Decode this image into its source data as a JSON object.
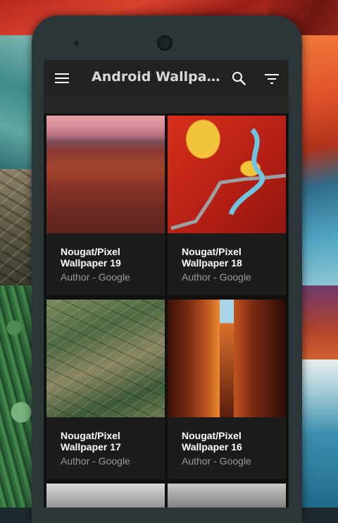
{
  "appbar": {
    "title": "Android Wallpap..."
  },
  "icons": {
    "menu": "menu-icon",
    "search": "search-icon",
    "filter": "filter-icon"
  },
  "wallpapers": [
    {
      "title": "Nougat/Pixel Wallpaper 19",
      "author": "Author - Google"
    },
    {
      "title": "Nougat/Pixel Wallpaper 18",
      "author": "Author - Google"
    },
    {
      "title": "Nougat/Pixel Wallpaper 17",
      "author": "Author - Google"
    },
    {
      "title": "Nougat/Pixel Wallpaper 16",
      "author": "Author - Google"
    }
  ],
  "colors": {
    "appbar": "#222222",
    "screen_background": "#101010",
    "card_background": "#1c1c1c",
    "title_text": "#d8d8d8",
    "card_title": "#ffffff",
    "card_author": "#9a9a9a",
    "phone_body": "#2c3537"
  }
}
